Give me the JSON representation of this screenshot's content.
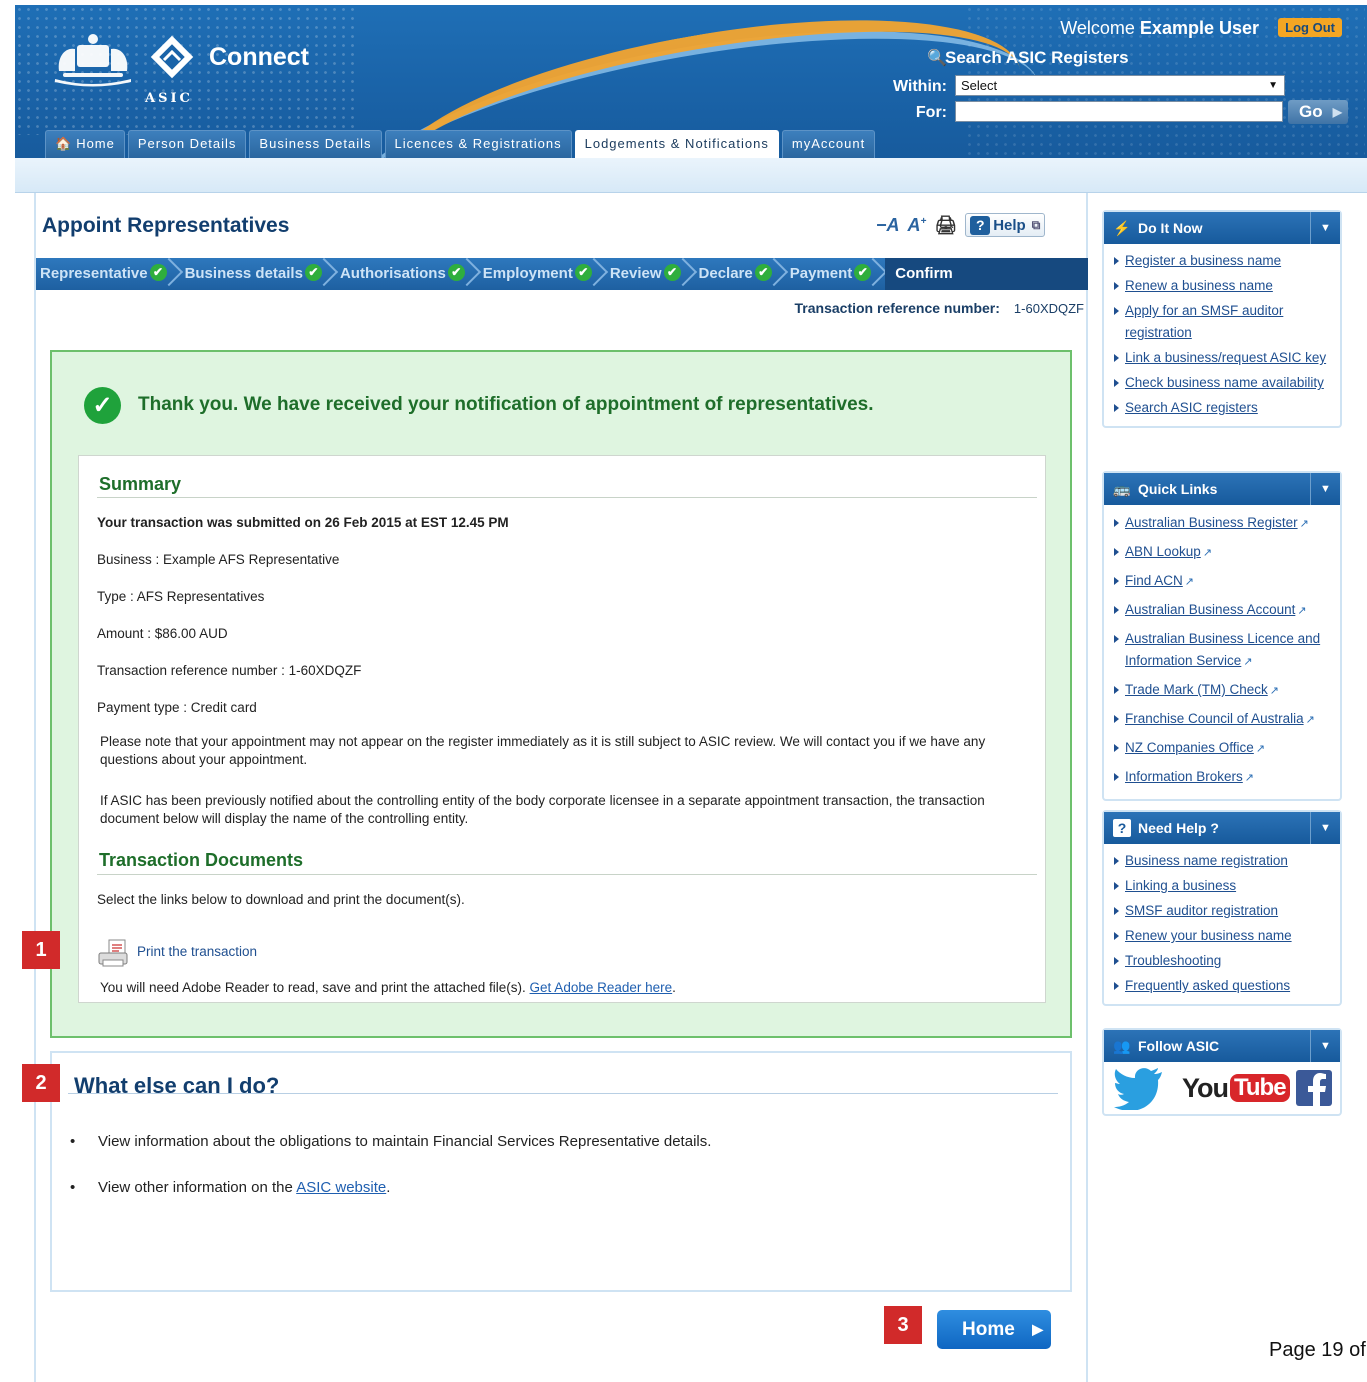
{
  "header": {
    "app_name": "Connect",
    "agency": "ASIC",
    "welcome_prefix": "Welcome",
    "user_name": "Example User",
    "logout_label": "Log Out",
    "search_title": "Search ASIC Registers",
    "within_label": "Within:",
    "within_value": "Select",
    "for_label": "For:",
    "go_label": "Go"
  },
  "nav": {
    "tabs": [
      {
        "label": "Home"
      },
      {
        "label": "Person Details"
      },
      {
        "label": "Business Details"
      },
      {
        "label": "Licences & Registrations"
      },
      {
        "label": "Lodgements & Notifications",
        "active": true
      },
      {
        "label": "myAccount"
      }
    ]
  },
  "page": {
    "title": "Appoint Representatives",
    "help_label": "Help",
    "steps": [
      "Representative",
      "Business details",
      "Authorisations",
      "Employment",
      "Review",
      "Declare",
      "Payment",
      "Confirm"
    ],
    "trn_label": "Transaction reference number:",
    "trn_value": "1-60XDQZF"
  },
  "success": {
    "message": "Thank you. We have received your notification of appointment of representatives.",
    "summary_heading": "Summary",
    "submitted": "Your transaction was submitted on 26 Feb 2015 at EST 12.45 PM",
    "business": "Business : Example AFS Representative",
    "type": "Type : AFS Representatives",
    "amount": "Amount : $86.00 AUD",
    "trn": "Transaction reference number : 1-60XDQZF",
    "payment_type": "Payment type : Credit card",
    "note1": "Please note that your appointment may not appear on the register immediately as it is still subject to ASIC review. We will contact you if we have any questions about your appointment.",
    "note2": "If ASIC has been previously notified about the controlling entity of the body corporate licensee in a separate appointment transaction, the transaction document below will display the name of the controlling entity.",
    "docs_heading": "Transaction Documents",
    "docs_instruction": "Select the links below to download and print the document(s).",
    "print_link": "Print the transaction",
    "adobe_text": "You will need Adobe Reader to read, save and print the attached file(s).",
    "adobe_link": "Get Adobe Reader here",
    "adobe_suffix": "."
  },
  "what_else": {
    "title": "What else can I do?",
    "item1": "View information about the obligations to maintain Financial Services Representative details.",
    "item2_prefix": "View other information on the",
    "item2_link": "ASIC website",
    "item2_suffix": "."
  },
  "home_button": "Home",
  "markers": [
    "1",
    "2",
    "3"
  ],
  "page_number": "Page 19 of",
  "sidebar": {
    "do_it_now": {
      "title": "Do It Now",
      "items": [
        "Register a business name",
        "Renew a business name",
        "Apply for an SMSF auditor registration",
        "Link a business/request ASIC key",
        "Check business name availability",
        "Search ASIC registers"
      ]
    },
    "quick_links": {
      "title": "Quick Links",
      "items": [
        "Australian Business Register",
        "ABN Lookup",
        "Find ACN",
        "Australian Business Account",
        "Australian Business Licence and Information Service",
        "Trade Mark (TM) Check",
        "Franchise Council of Australia",
        "NZ Companies Office",
        "Information Brokers"
      ]
    },
    "need_help": {
      "title": "Need Help ?",
      "items": [
        "Business name registration",
        "Linking a business",
        "SMSF auditor registration",
        "Renew your business name",
        "Troubleshooting",
        "Frequently asked questions"
      ]
    },
    "follow": {
      "title": "Follow ASIC",
      "youtube_you": "You",
      "youtube_tube": "Tube"
    }
  },
  "colors": {
    "brand_blue": "#1a63a8",
    "accent_orange": "#f4a623",
    "success_green": "#1fa23b",
    "marker_red": "#d12a2a"
  }
}
